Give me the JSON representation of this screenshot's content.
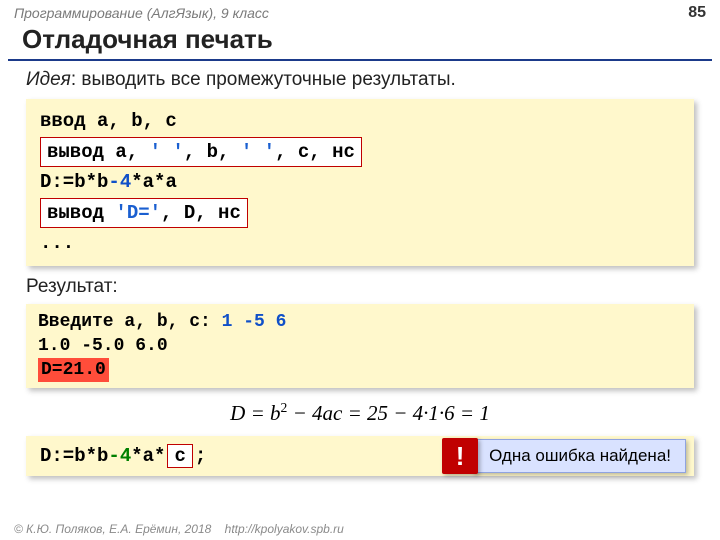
{
  "header": {
    "course": "Программирование (АлгЯзык), 9 класс",
    "pageNumber": "85"
  },
  "title": "Отладочная печать",
  "idea": {
    "label": "Идея",
    "text": ": выводить все промежуточные результаты."
  },
  "code": {
    "l1": "ввод a, b, c",
    "l2_a": "вывод a, ",
    "l2_s1": "' '",
    "l2_b": ", b, ",
    "l2_s2": "' '",
    "l2_c": ", c, нс",
    "l3_a": "D:=b*b",
    "l3_m": "-4",
    "l3_b": "*a*a",
    "l4_a": "вывод ",
    "l4_s": "'D='",
    "l4_b": ", D, нс",
    "l5": "..."
  },
  "resultLabel": "Результат:",
  "result": {
    "r1_a": "Введите a, b, c: ",
    "r1_b": "1 -5 6",
    "r2": "1.0 -5.0 6.0",
    "r3": "D=21.0"
  },
  "formula": {
    "lhs": "D = b",
    "sup": "2",
    "mid": " − 4ac = 25 − 4·1·6 = 1"
  },
  "fix": {
    "pre": "D:=b*b",
    "minus4": "-4",
    "mid": "*a*",
    "c": "c",
    "post": ";"
  },
  "callout": {
    "bang": "!",
    "msg": "Одна ошибка найдена!"
  },
  "footer": {
    "copyright": "© К.Ю. Поляков, Е.А. Ерёмин, 2018",
    "url": "http://kpolyakov.spb.ru"
  }
}
